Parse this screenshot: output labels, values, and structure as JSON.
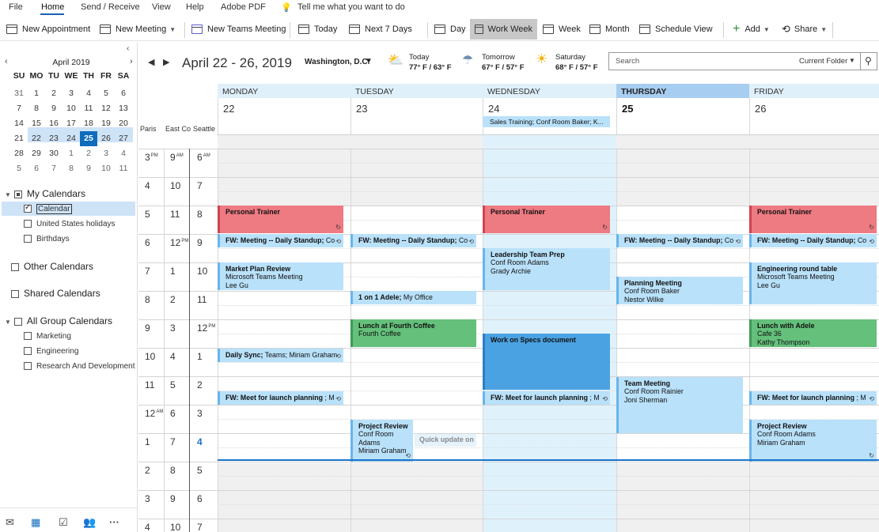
{
  "menu": [
    "File",
    "Home",
    "Send / Receive",
    "View",
    "Help",
    "Adobe PDF"
  ],
  "tell_me": "Tell me what you want to do",
  "toolbar": {
    "new_appointment": "New Appointment",
    "new_meeting": "New Meeting",
    "new_teams_meeting": "New Teams Meeting",
    "today": "Today",
    "next7": "Next 7 Days",
    "day": "Day",
    "work_week": "Work Week",
    "week": "Week",
    "month": "Month",
    "schedule_view": "Schedule View",
    "add": "Add",
    "share": "Share"
  },
  "mini_calendar": {
    "month": "April 2019",
    "weekdays": [
      "SU",
      "MO",
      "TU",
      "WE",
      "TH",
      "FR",
      "SA"
    ],
    "weeks": [
      [
        "31",
        "1",
        "2",
        "3",
        "4",
        "5",
        "6"
      ],
      [
        "7",
        "8",
        "9",
        "10",
        "11",
        "12",
        "13"
      ],
      [
        "14",
        "15",
        "16",
        "17",
        "18",
        "19",
        "20"
      ],
      [
        "21",
        "22",
        "23",
        "24",
        "25",
        "26",
        "27"
      ],
      [
        "28",
        "29",
        "30",
        "1",
        "2",
        "3",
        "4"
      ],
      [
        "5",
        "6",
        "7",
        "8",
        "9",
        "10",
        "11"
      ]
    ],
    "today": "25"
  },
  "folders": {
    "my_calendars": "My Calendars",
    "calendar": "Calendar",
    "us_holidays": "United States holidays",
    "birthdays": "Birthdays",
    "other": "Other Calendars",
    "shared": "Shared Calendars",
    "all_group": "All Group Calendars",
    "marketing": "Marketing",
    "engineering": "Engineering",
    "rnd": "Research And Development"
  },
  "view": {
    "range": "April 22 - 26, 2019",
    "location": "Washington, D.C.",
    "weather": [
      {
        "label": "Today",
        "temp": "77° F / 63° F"
      },
      {
        "label": "Tomorrow",
        "temp": "67° F / 57° F"
      },
      {
        "label": "Saturday",
        "temp": "68° F / 57° F"
      }
    ],
    "search_placeholder": "Search",
    "search_scope": "Current Folder"
  },
  "days": [
    {
      "name": "MONDAY",
      "num": "22"
    },
    {
      "name": "TUESDAY",
      "num": "23"
    },
    {
      "name": "WEDNESDAY",
      "num": "24"
    },
    {
      "name": "THURSDAY",
      "num": "25"
    },
    {
      "name": "FRIDAY",
      "num": "26"
    }
  ],
  "timezones": [
    "Paris",
    "East Co",
    "Seattle"
  ],
  "hours": {
    "paris": [
      "3",
      "4",
      "5",
      "6",
      "7",
      "8",
      "9",
      "10",
      "11",
      "12",
      "1",
      "2",
      "3",
      "4"
    ],
    "east": [
      "9",
      "10",
      "11",
      "12",
      "1",
      "2",
      "3",
      "4",
      "5",
      "6",
      "7",
      "8",
      "9",
      "10"
    ],
    "seattle": [
      "6",
      "7",
      "8",
      "9",
      "10",
      "11",
      "12",
      "1",
      "2",
      "3",
      "4",
      "5",
      "6",
      "7"
    ]
  },
  "ampm": {
    "pm": "PM",
    "am": "AM"
  },
  "allday_event": "Sales Training; Conf Room Baker; K...",
  "events": {
    "trainer": "Personal Trainer",
    "standup_b": "FW: Meeting -- Daily Standup;",
    "standup_r": " Co",
    "market_1": "Market Plan Review",
    "market_2": "Microsoft Teams Meeting",
    "market_3": "Lee Gu",
    "sync_b": "Daily Sync;",
    "sync_r": " Teams; Miriam Graham",
    "launch_b": "FW: Meet for launch planning",
    "launch_r": " ; M",
    "adele_b": "1 on 1 Adele;",
    "adele_r": " My Office",
    "lunch4_1": "Lunch at Fourth Coffee",
    "lunch4_2": "Fourth Coffee",
    "proj_1": "Project Review",
    "proj_2": "Conf Room",
    "proj_3": "Adams",
    "proj_4": "Miriam Graham",
    "quick": "Quick update on",
    "lead_1": "Leadership Team Prep",
    "lead_2": "Conf Room Adams",
    "lead_3": "Grady Archie",
    "specs": "Work on Specs document",
    "plan_1": "Planning Meeting",
    "plan_2": "Conf Room Baker",
    "plan_3": "Nestor Wilke",
    "team_1": "Team Meeting",
    "team_2": "Conf Room Rainier",
    "team_3": "Joni Sherman",
    "eng_1": "Engineering round table",
    "eng_2": "Microsoft Teams Meeting",
    "eng_3": "Lee Gu",
    "lunchA_1": "Lunch with Adele",
    "lunchA_2": "Cafe 36",
    "lunchA_3": "Kathy Thompson",
    "projF_1": "Project Review",
    "projF_2": "Conf Room Adams",
    "projF_3": "Miriam Graham"
  }
}
